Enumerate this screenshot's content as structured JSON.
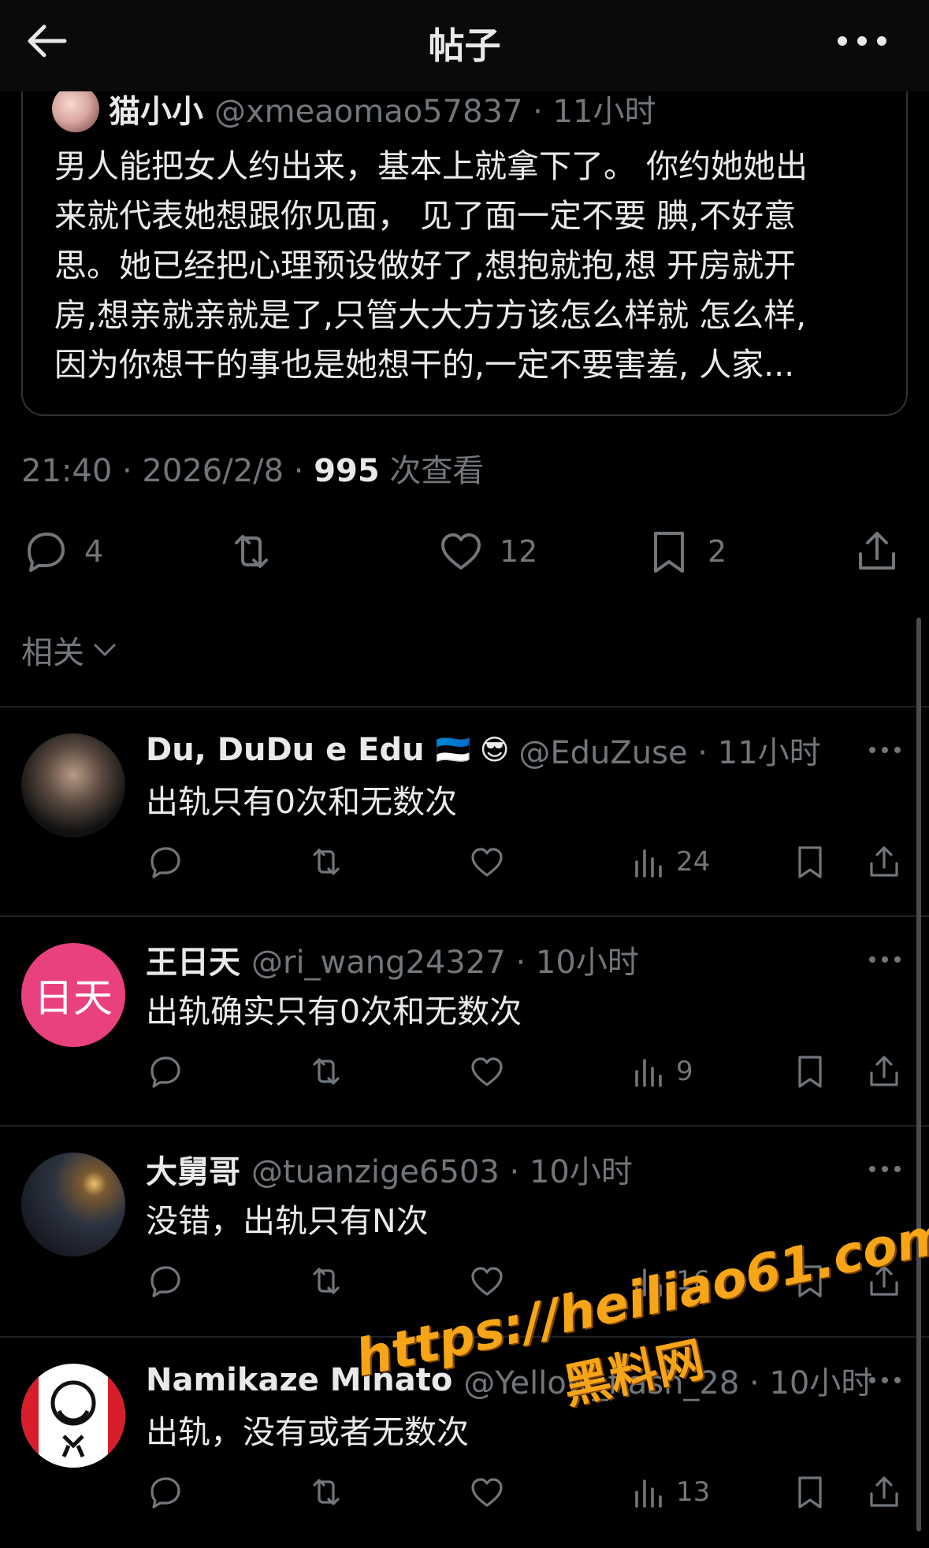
{
  "header": {
    "title": "帖子"
  },
  "quote": {
    "name": "猫小小",
    "handle": "@xmeaomao57837 · 11小时",
    "lines": [
      "男人能把女人约出来，基本上就拿下了。 你约她她出",
      "来就代表她想跟你见面， 见了面一定不要 腆,不好意",
      "思。她已经把心理预设做好了,想抱就抱,想 开房就开",
      "房,想亲就亲就是了,只管大大方方该怎么样就 怎么样,",
      "因为你想干的事也是她想干的,一定不要害羞, 人家..."
    ]
  },
  "post_meta": {
    "time_date": "21:40 · 2026/2/8 · ",
    "views": "995",
    "views_label": " 次查看"
  },
  "actions": {
    "replies": "4",
    "likes": "12",
    "bookmarks": "2"
  },
  "related": {
    "label": "相关"
  },
  "replies": [
    {
      "name": "Du, DuDu e Edu",
      "emoji": "🇪🇪 😎",
      "handle": "@EduZuse · 11小时",
      "text": "出轨只有0次和无数次",
      "views": "24",
      "avatar_color": "#2a2a2a"
    },
    {
      "name": "王日天",
      "emoji": "",
      "handle": "@ri_wang24327 · 10小时",
      "text": "出轨确实只有0次和无数次",
      "views": "9",
      "avatar_text": "日天",
      "avatar_color": "#e9417e"
    },
    {
      "name": "大舅哥",
      "emoji": "",
      "handle": "@tuanzige6503 · 10小时",
      "text": "没错，出轨只有N次",
      "views": "16",
      "avatar_color": "#3a4150"
    },
    {
      "name": "Namikaze Minato",
      "emoji": "",
      "handle": "@Yellow_flash_28 · 10小时",
      "text": "出轨，没有或者无数次",
      "views": "13",
      "avatar_color": "#ffffff"
    }
  ],
  "watermark": {
    "url": "https://heiliao61.com",
    "label": "黑料网"
  },
  "colors": {
    "background": "#000000",
    "text": "#e7e9ea",
    "muted": "#71767b",
    "watermark": "#f7a518"
  }
}
